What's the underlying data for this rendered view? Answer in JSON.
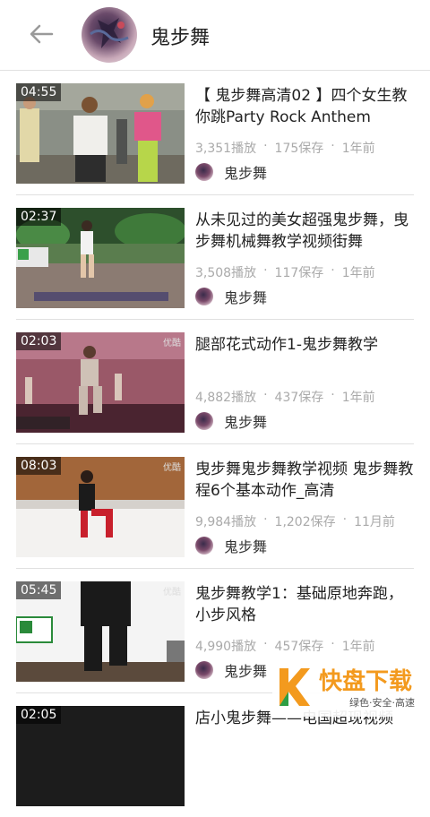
{
  "header": {
    "title": "鬼步舞"
  },
  "videos": [
    {
      "duration": "04:55",
      "title": "【 鬼步舞高清02 】四个女生教你跳Party Rock Anthem",
      "plays": "3,351播放",
      "saves": "175保存",
      "time": "1年前",
      "author": "鬼步舞",
      "badge": ""
    },
    {
      "duration": "02:37",
      "title": "从未见过的美女超强鬼步舞，曳步舞机械舞教学视频街舞",
      "plays": "3,508播放",
      "saves": "117保存",
      "time": "1年前",
      "author": "鬼步舞",
      "badge": ""
    },
    {
      "duration": "02:03",
      "title": "腿部花式动作1-鬼步舞教学",
      "plays": "4,882播放",
      "saves": "437保存",
      "time": "1年前",
      "author": "鬼步舞",
      "badge": "优酷"
    },
    {
      "duration": "08:03",
      "title": "曳步舞鬼步舞教学视频 鬼步舞教程6个基本动作_高清",
      "plays": "9,984播放",
      "saves": "1,202保存",
      "time": "11月前",
      "author": "鬼步舞",
      "badge": "优酷"
    },
    {
      "duration": "05:45",
      "title": "鬼步舞教学1：基础原地奔跑，小步风格",
      "plays": "4,990播放",
      "saves": "457保存",
      "time": "1年前",
      "author": "鬼步舞",
      "badge": "优酷"
    },
    {
      "duration": "02:05",
      "title": "店小鬼步舞——电国超现视频",
      "plays": "",
      "saves": "",
      "time": "",
      "author": "",
      "badge": ""
    }
  ],
  "watermark": {
    "brand": "快盘下载",
    "slogan": "绿色·安全·高速"
  },
  "colors": {
    "accent": "#f39a1e",
    "meta_text": "#aaaaaa"
  }
}
